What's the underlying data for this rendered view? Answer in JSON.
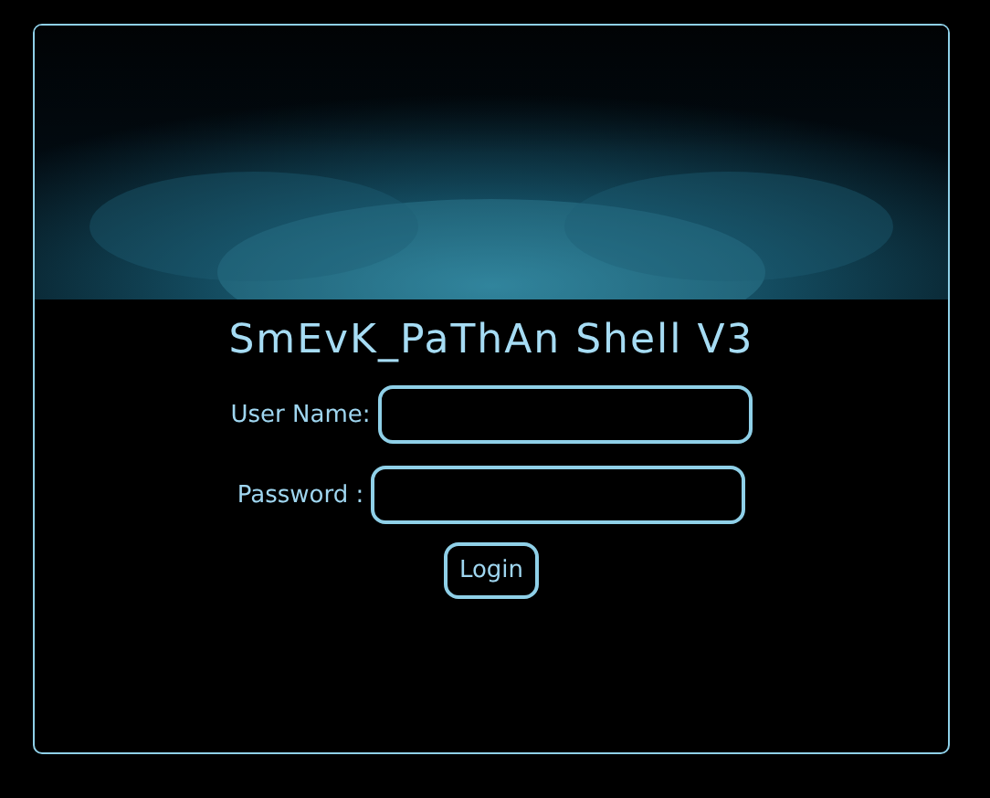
{
  "title": "SmEvK_PaThAn Shell V3",
  "fields": [
    {
      "label": "User Name:"
    },
    {
      "label": "Password :"
    }
  ],
  "button": "Login"
}
